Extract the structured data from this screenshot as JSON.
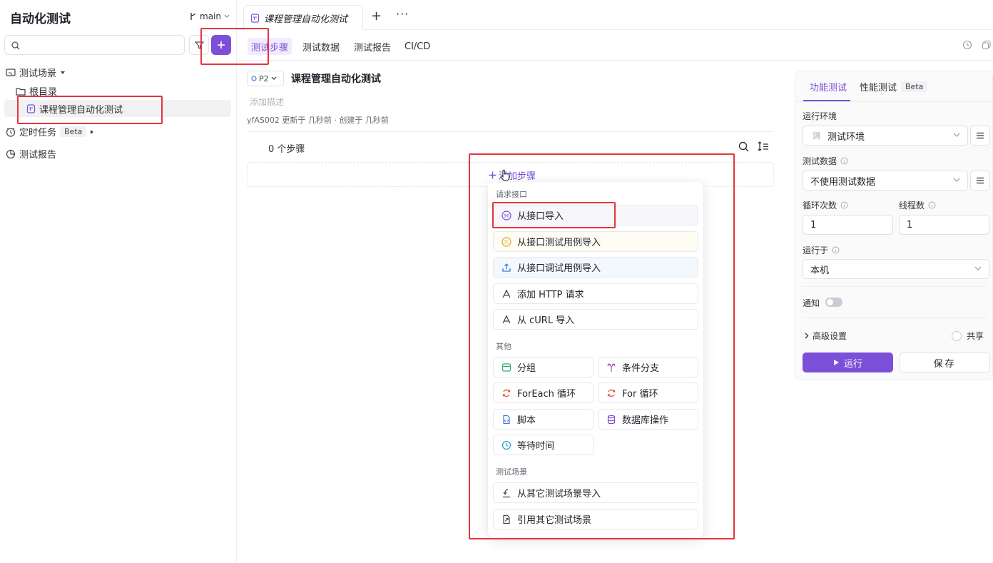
{
  "sidebar": {
    "title": "自动化测试",
    "branch": "main",
    "tree": {
      "scenes": "测试场景",
      "root": "根目录",
      "case": "课程管理自动化测试",
      "tasks": "定时任务",
      "tasks_badge": "Beta",
      "reports": "测试报告"
    }
  },
  "tabs": {
    "doc_tab": "课程管理自动化测试",
    "plus": "+",
    "more": "···"
  },
  "subtabs": {
    "steps": "测试步骤",
    "data": "测试数据",
    "report": "测试报告",
    "cicd": "CI/CD"
  },
  "main": {
    "priority": "P2",
    "title": "课程管理自动化测试",
    "add_desc": "添加描述",
    "meta": "yfAS002 更新于 几秒前 · 创建于 几秒前",
    "step_count": "0 个步骤",
    "add_step": "添加步骤"
  },
  "dropdown": {
    "section_request": "请求接口",
    "import_api": "从接口导入",
    "import_api_case": "从接口测试用例导入",
    "import_debug_case": "从接口调试用例导入",
    "add_http": "添加 HTTP 请求",
    "import_curl": "从 cURL 导入",
    "section_other": "其他",
    "group": "分组",
    "condition": "条件分支",
    "foreach": "ForEach 循环",
    "for_loop": "For 循环",
    "script": "脚本",
    "db": "数据库操作",
    "wait": "等待时间",
    "section_scene": "测试场景",
    "import_scene": "从其它测试场景导入",
    "ref_scene": "引用其它测试场景"
  },
  "panel": {
    "tab_func": "功能测试",
    "tab_perf": "性能测试",
    "tab_perf_badge": "Beta",
    "env_label": "运行环境",
    "env_icon_text": "测",
    "env_value": "测试环境",
    "data_label": "测试数据",
    "data_value": "不使用测试数据",
    "loop_label": "循环次数",
    "loop_value": "1",
    "thread_label": "线程数",
    "thread_value": "1",
    "run_on_label": "运行于",
    "run_on_value": "本机",
    "notify_label": "通知",
    "advanced": "高级设置",
    "share": "共享",
    "run": "运行",
    "save": "保存"
  },
  "colors": {
    "accent": "#7b4fd8",
    "annotation": "#e8343c"
  }
}
